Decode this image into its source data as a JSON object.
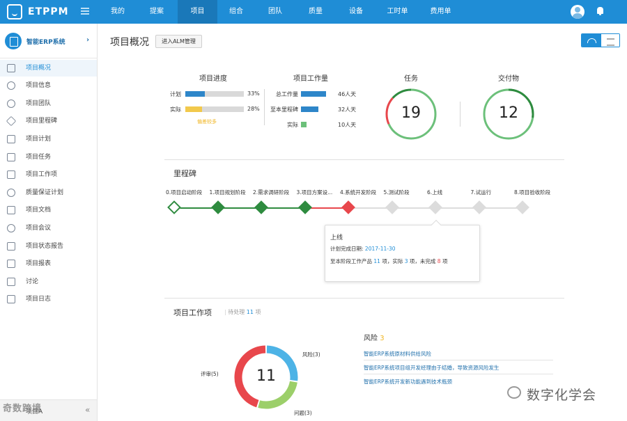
{
  "brand": {
    "name": "ETPPM"
  },
  "nav": [
    "我的",
    "提案",
    "项目",
    "组合",
    "团队",
    "质量",
    "设备",
    "工时单",
    "费用单"
  ],
  "sidebar": {
    "system_name": "智能ERP系统",
    "items": [
      "项目概况",
      "项目信息",
      "项目团队",
      "项目里程碑",
      "项目计划",
      "项目任务",
      "项目工作项",
      "质量保证计划",
      "项目文档",
      "项目会议",
      "项目状态报告",
      "项目报表",
      "讨论",
      "项目日志"
    ],
    "bottom_label": "项目A",
    "watermark": "奇数跨境"
  },
  "header": {
    "title": "项目概况",
    "alm_button": "进入ALM管理"
  },
  "progress": {
    "title": "项目进度",
    "rows": [
      {
        "label": "计划",
        "percent": 33,
        "value": "33%",
        "color": "#2e86c9"
      },
      {
        "label": "实际",
        "percent": 28,
        "value": "28%",
        "color": "#f2c94c"
      }
    ],
    "link": "偏差较多"
  },
  "workload": {
    "title": "项目工作量",
    "rows": [
      {
        "label": "总工作量",
        "days": 46,
        "value": "46人天",
        "color": "#2e86c9"
      },
      {
        "label": "至本里程碑",
        "days": 32,
        "value": "32人天",
        "color": "#2e86c9"
      },
      {
        "label": "实际",
        "days": 10,
        "value": "10人天",
        "color": "#6cc07a"
      }
    ]
  },
  "tasks": {
    "title": "任务",
    "count": "19"
  },
  "deliverables": {
    "title": "交付物",
    "count": "12"
  },
  "milestones": {
    "title": "里程碑",
    "items": [
      {
        "label": "0.项目启动阶段",
        "state": "done-outline"
      },
      {
        "label": "1.项目规划阶段",
        "state": "done"
      },
      {
        "label": "2.需求调研阶段",
        "state": "done"
      },
      {
        "label": "3.项目方案设...",
        "state": "done"
      },
      {
        "label": "4.系统开发阶段",
        "state": "current"
      },
      {
        "label": "5.测试阶段",
        "state": "todo"
      },
      {
        "label": "6.上线",
        "state": "todo"
      },
      {
        "label": "7.试运行",
        "state": "todo"
      },
      {
        "label": "8.项目验收阶段",
        "state": "todo"
      }
    ],
    "popup": {
      "title": "上线",
      "plan_label": "计划完成日期:",
      "plan_date": "2017-11-30",
      "summary_prefix": "至本阶段工作产品",
      "total": "11",
      "mid1": "项，实际",
      "actual": "3",
      "mid2": "项，未完成",
      "undone": "8",
      "suffix": "项"
    }
  },
  "work_items": {
    "title": "项目工作项",
    "pending_prefix": "待处理",
    "pending_count": "11",
    "pending_suffix": "项",
    "total": "11",
    "segments": [
      {
        "name": "风险(3)",
        "value": 3,
        "color": "#4db3e6"
      },
      {
        "name": "问题(3)",
        "value": 3,
        "color": "#9ccf6a"
      },
      {
        "name": "评审(5)",
        "value": 5,
        "color": "#e8474c"
      }
    ]
  },
  "risks": {
    "title": "风险",
    "count": "3",
    "items": [
      "智能ERP系统原材料供给风险",
      "智能ERP系统项目组开发经理由于结婚，导致资源风险发生",
      "智能ERP系统开发新功能遇到技术瓶颈"
    ]
  },
  "watermark": "数字化学会",
  "colors": {
    "primary": "#1f8dd6",
    "done": "#2e8b3f",
    "current": "#e8474c",
    "todo": "#dcdcdc"
  }
}
